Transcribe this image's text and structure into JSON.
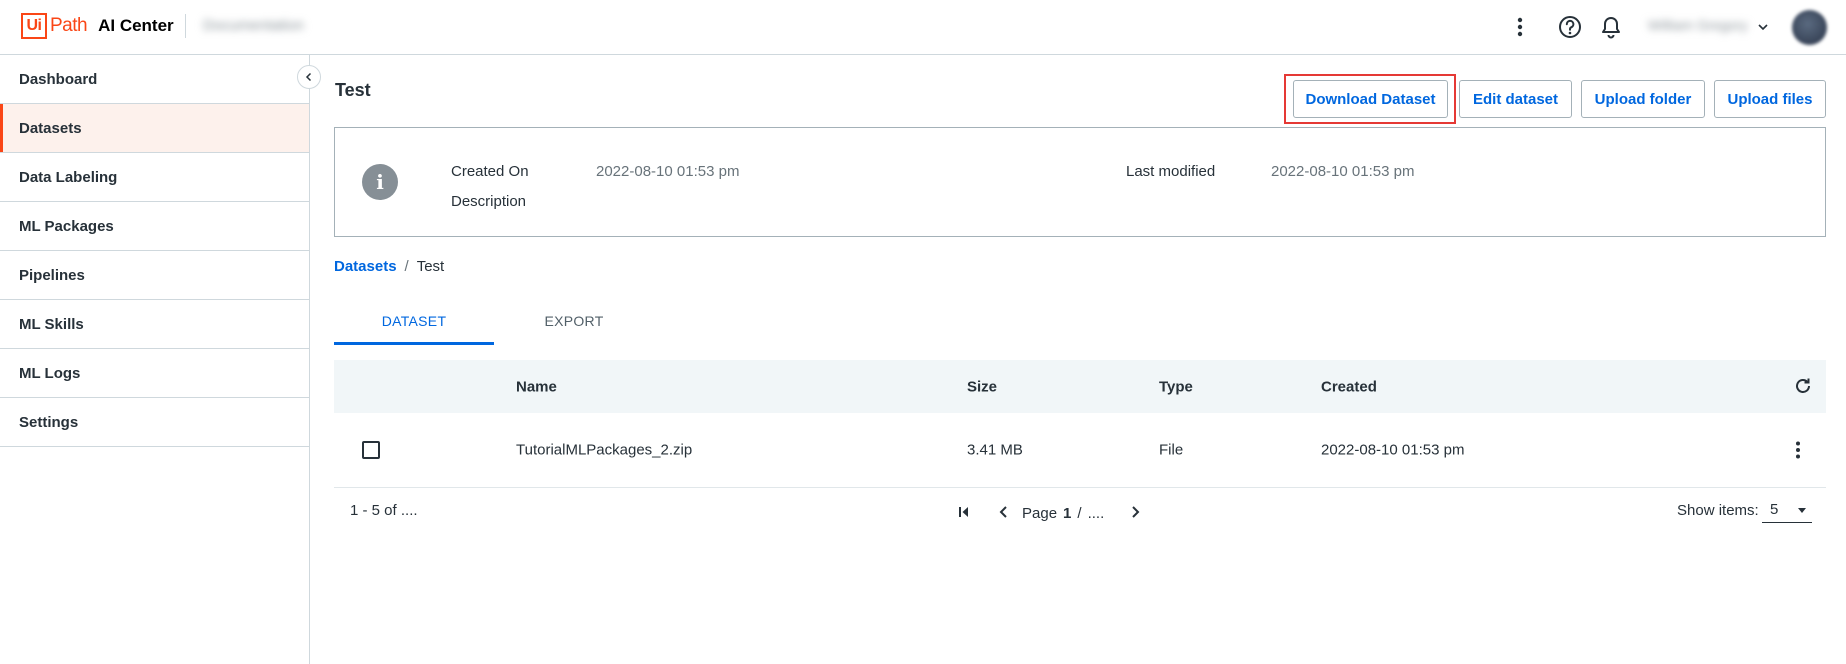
{
  "header": {
    "logo_ui": "Ui",
    "logo_path": "Path",
    "product": "AI Center",
    "org_name": "Documentation",
    "user_name": "William Gregory",
    "icons": [
      "more-vert-icon",
      "help-icon",
      "bell-icon",
      "chevron-down-icon",
      "avatar"
    ]
  },
  "sidebar": {
    "items": [
      {
        "label": "Dashboard",
        "active": false
      },
      {
        "label": "Datasets",
        "active": true
      },
      {
        "label": "Data Labeling",
        "active": false
      },
      {
        "label": "ML Packages",
        "active": false
      },
      {
        "label": "Pipelines",
        "active": false
      },
      {
        "label": "ML Skills",
        "active": false
      },
      {
        "label": "ML Logs",
        "active": false
      },
      {
        "label": "Settings",
        "active": false
      }
    ]
  },
  "page": {
    "title": "Test",
    "actions": {
      "download": "Download Dataset",
      "edit": "Edit dataset",
      "upload_folder": "Upload folder",
      "upload_files": "Upload files"
    },
    "info": {
      "created_on_label": "Created On",
      "created_on_value": "2022-08-10 01:53 pm",
      "description_label": "Description",
      "last_modified_label": "Last modified",
      "last_modified_value": "2022-08-10 01:53 pm"
    },
    "breadcrumb": {
      "parent": "Datasets",
      "separator": "/",
      "current": "Test"
    },
    "tabs": [
      {
        "label": "DATASET",
        "active": true
      },
      {
        "label": "EXPORT",
        "active": false
      }
    ]
  },
  "table": {
    "headers": {
      "name": "Name",
      "size": "Size",
      "type": "Type",
      "created": "Created"
    },
    "rows": [
      {
        "name": "TutorialMLPackages_2.zip",
        "size": "3.41 MB",
        "type": "File",
        "created": "2022-08-10 01:53 pm"
      }
    ]
  },
  "pagination": {
    "range": "1 - 5 of ....",
    "page_label": "Page",
    "page_current": "1",
    "page_sep": "/",
    "page_total": "....",
    "show_items_label": "Show items:",
    "show_items_value": "5"
  },
  "colors": {
    "brand": "#fa4616",
    "link": "#0067df",
    "highlight": "#e53935",
    "active_nav_bg": "#fdf1ec"
  }
}
